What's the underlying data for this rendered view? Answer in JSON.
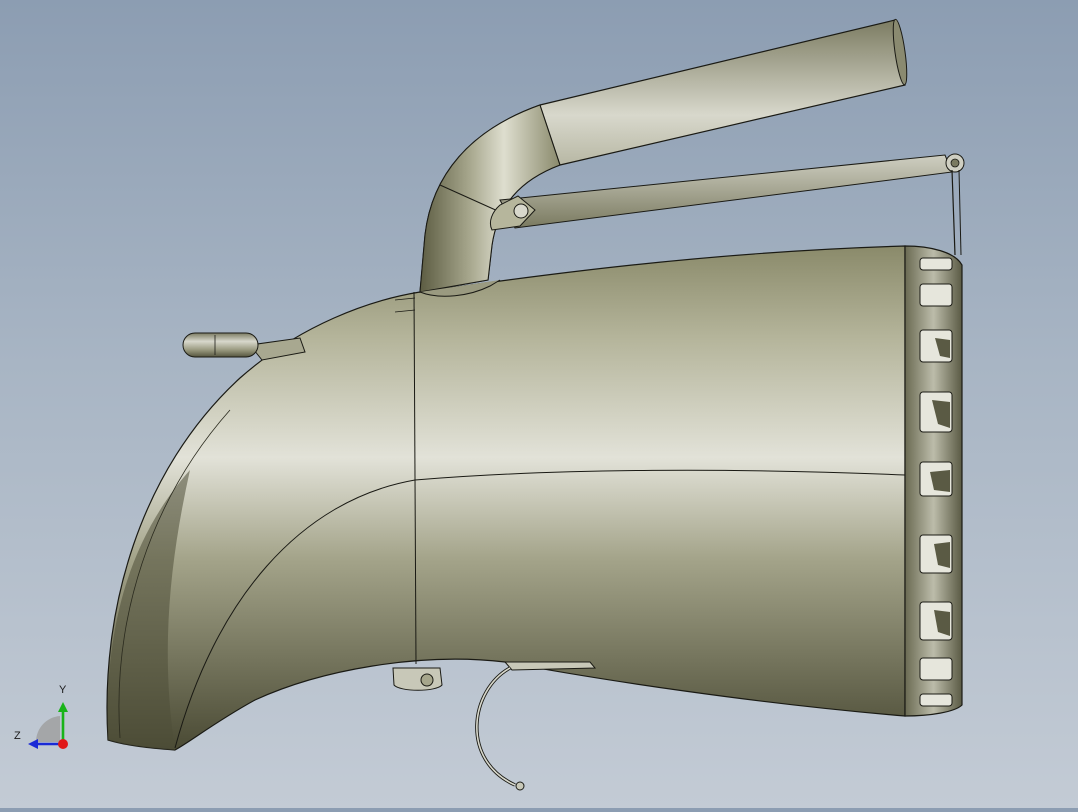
{
  "viewport": {
    "background_top": "#8c9db2",
    "background_bottom": "#c3cbd5",
    "model": {
      "body_color": "#6e6e52",
      "highlight_color": "#e4e4dc",
      "edge_color": "#1a1a14"
    }
  },
  "triad": {
    "y_label": "Y",
    "z_label": "Z",
    "colors": {
      "y": "#19b319",
      "z": "#1a2ad6",
      "x": "#e01818"
    }
  }
}
